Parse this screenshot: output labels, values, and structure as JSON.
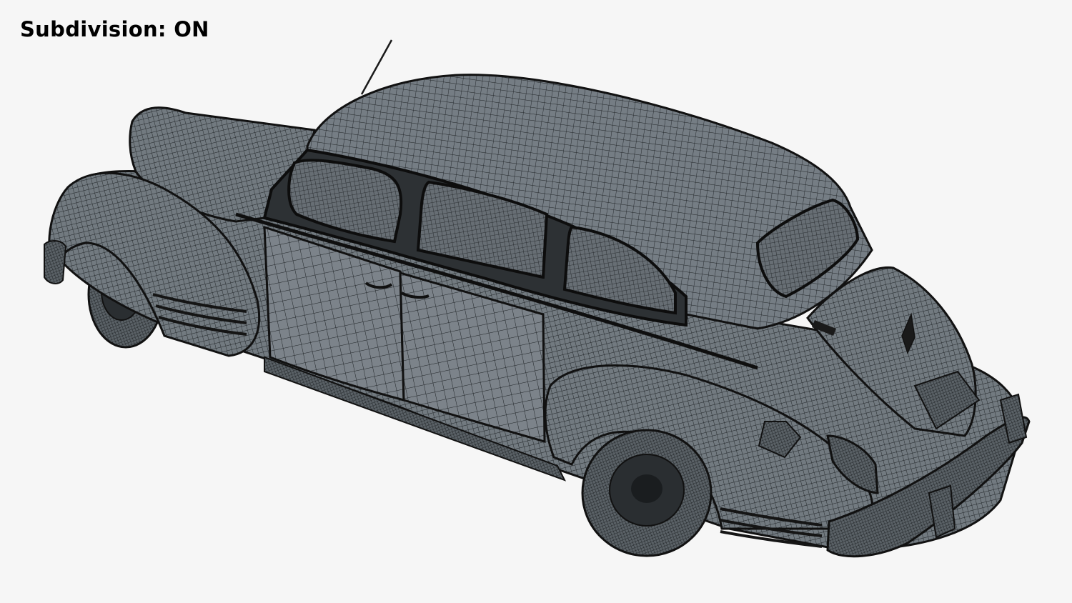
{
  "overlay": {
    "subdivision_text": "Subdivision: ON"
  },
  "model": {
    "subject": "vintage-sedan-wireframe",
    "render_mode": "wireframe-on-shaded"
  },
  "colors": {
    "background": "#f6f6f6",
    "surface": "#6f767c",
    "wire": "#1a1a1a",
    "label": "#000000"
  }
}
